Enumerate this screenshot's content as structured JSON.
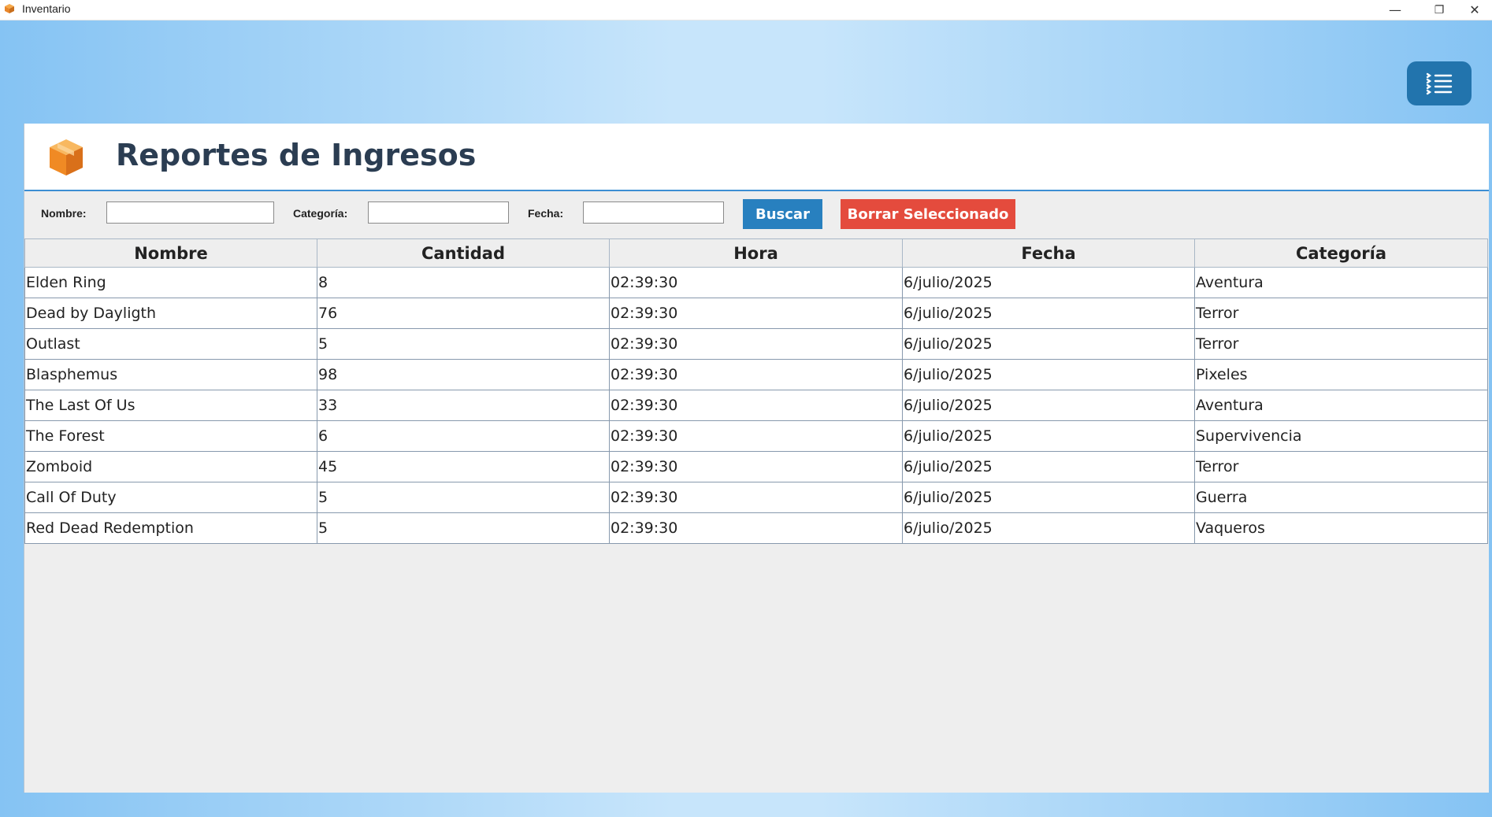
{
  "window": {
    "title": "Inventario",
    "controls": {
      "minimize": "—",
      "restore": "❐",
      "close": "✕"
    }
  },
  "header": {
    "title": "Reportes de Ingresos",
    "icon": "box-icon"
  },
  "menu_button": {
    "icon": "list-menu-icon",
    "color": "#2274ad"
  },
  "filters": {
    "nombre_label": "Nombre:",
    "nombre_value": "",
    "categoria_label": "Categoría:",
    "categoria_value": "",
    "fecha_label": "Fecha:",
    "fecha_value": "",
    "search_button": "Buscar",
    "delete_button": "Borrar Seleccionado"
  },
  "colors": {
    "accent_blue": "#2880bf",
    "danger_red": "#e44b3d",
    "title_text": "#2b3d52"
  },
  "table": {
    "columns": [
      "Nombre",
      "Cantidad",
      "Hora",
      "Fecha",
      "Categoría"
    ],
    "rows": [
      [
        "Elden Ring",
        "8",
        "02:39:30",
        "6/julio/2025",
        "Aventura"
      ],
      [
        "Dead by Dayligth",
        "76",
        "02:39:30",
        "6/julio/2025",
        "Terror"
      ],
      [
        "Outlast",
        "5",
        "02:39:30",
        "6/julio/2025",
        "Terror"
      ],
      [
        "Blasphemus",
        "98",
        "02:39:30",
        "6/julio/2025",
        "Pixeles"
      ],
      [
        "The Last Of Us",
        "33",
        "02:39:30",
        "6/julio/2025",
        "Aventura"
      ],
      [
        "The Forest",
        "6",
        "02:39:30",
        "6/julio/2025",
        "Supervivencia"
      ],
      [
        "Zomboid",
        "45",
        "02:39:30",
        "6/julio/2025",
        "Terror"
      ],
      [
        "Call Of Duty",
        "5",
        "02:39:30",
        "6/julio/2025",
        "Guerra"
      ],
      [
        "Red Dead Redemption",
        "5",
        "02:39:30",
        "6/julio/2025",
        "Vaqueros"
      ]
    ]
  }
}
